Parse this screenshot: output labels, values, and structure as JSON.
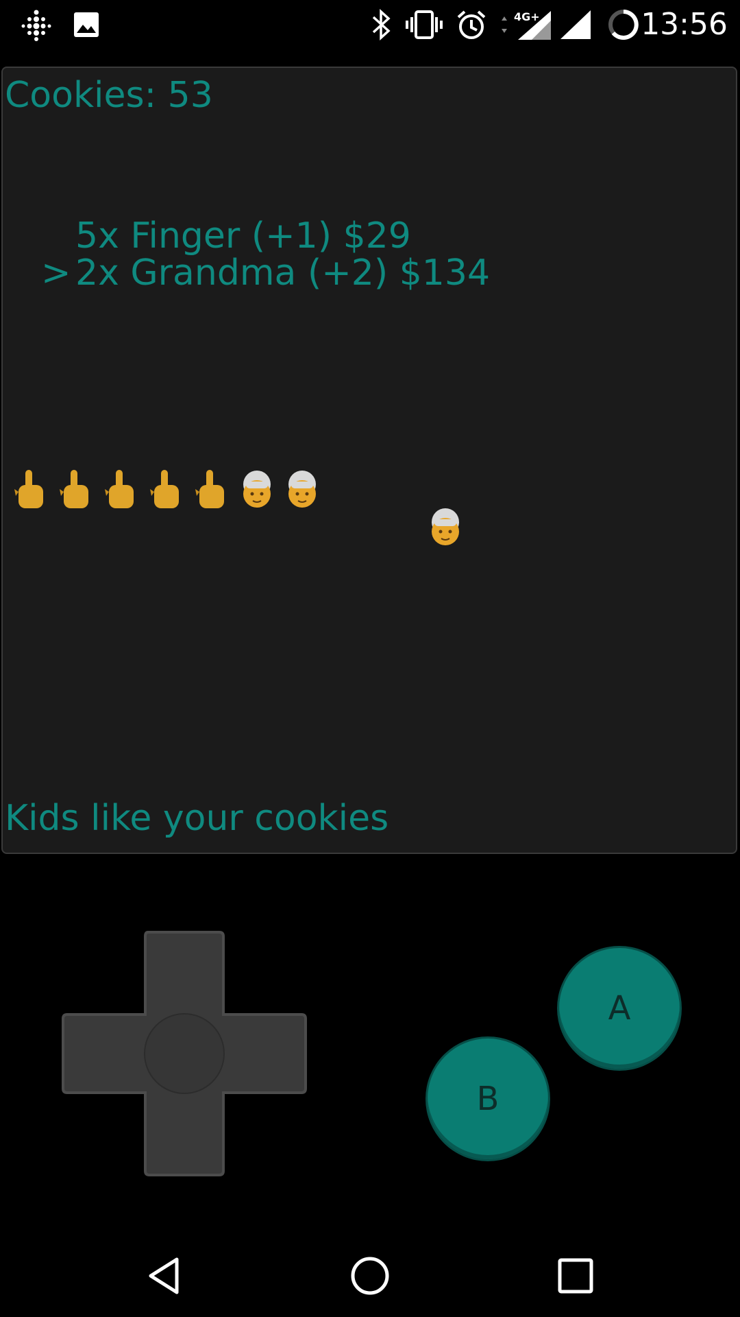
{
  "status_bar": {
    "time": "13:56",
    "network": "4G+",
    "icons": [
      "fitbit-icon",
      "image-icon",
      "bluetooth-icon",
      "vibrate-icon",
      "alarm-icon",
      "signal-4g-icon",
      "signal-icon",
      "battery-icon"
    ]
  },
  "game": {
    "score_label": "Cookies: 53",
    "shop": [
      {
        "cursor": "",
        "label": "5x Finger (+1) $29"
      },
      {
        "cursor": ">",
        "label": "2x Grandma (+2) $134"
      }
    ],
    "units": [
      "finger",
      "finger",
      "finger",
      "finger",
      "finger",
      "grandma",
      "grandma"
    ],
    "flying_unit": "grandma",
    "message": "Kids like your cookies",
    "colors": {
      "text": "#0f8a80",
      "background": "#1b1b1b",
      "button": "#0a7d72"
    }
  },
  "controls": {
    "a_label": "A",
    "b_label": "B"
  },
  "navbar": {
    "icons": [
      "back-icon",
      "home-icon",
      "recents-icon"
    ]
  }
}
